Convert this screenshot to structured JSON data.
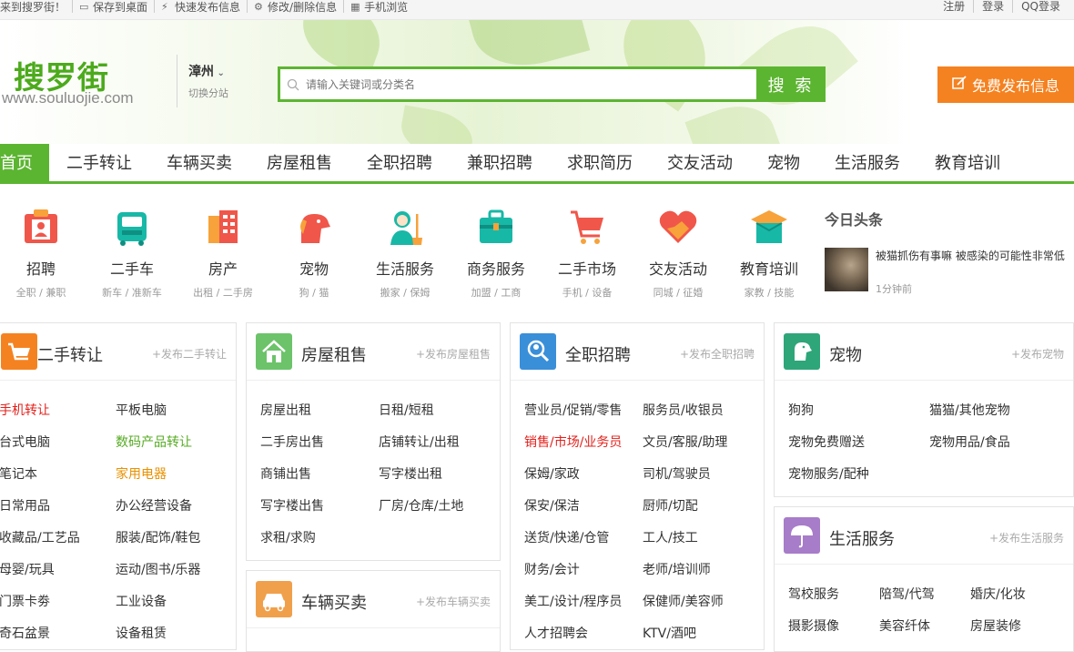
{
  "topbar": {
    "welcome": "迎来到搜罗街！",
    "save_desktop": "保存到桌面",
    "quick_post": "快速发布信息",
    "edit_delete": "修改/删除信息",
    "mobile": "手机浏览",
    "register": "注册",
    "login": "登录",
    "qq_login": "QQ登录"
  },
  "header": {
    "logo_cn": "搜罗街",
    "logo_url": "www.souluojie.com",
    "city": "漳州",
    "switch_city": "切换分站",
    "search_placeholder": "请输入关键词或分类名",
    "search_button": "搜 索",
    "publish_button": "免费发布信息"
  },
  "nav": [
    "首页",
    "二手转让",
    "车辆买卖",
    "房屋租售",
    "全职招聘",
    "兼职招聘",
    "求职简历",
    "交友活动",
    "宠物",
    "生活服务",
    "教育培训"
  ],
  "categories": [
    {
      "name": "招聘",
      "sub": "全职 / 兼职",
      "icon": "recruit-icon"
    },
    {
      "name": "二手车",
      "sub": "新车 / 准新车",
      "icon": "car-icon"
    },
    {
      "name": "房产",
      "sub": "出租 / 二手房",
      "icon": "building-icon"
    },
    {
      "name": "宠物",
      "sub": "狗 / 猫",
      "icon": "dog-icon"
    },
    {
      "name": "生活服务",
      "sub": "搬家 / 保姆",
      "icon": "cleaner-icon"
    },
    {
      "name": "商务服务",
      "sub": "加盟 / 工商",
      "icon": "briefcase-icon"
    },
    {
      "name": "二手市场",
      "sub": "手机 / 设备",
      "icon": "cart-icon"
    },
    {
      "name": "交友活动",
      "sub": "同城 / 征婚",
      "icon": "handshake-icon"
    },
    {
      "name": "教育培训",
      "sub": "家教 / 技能",
      "icon": "graduation-cap-icon"
    }
  ],
  "headline": {
    "title": "今日头条",
    "news_text": "被猫抓伤有事嘛 被感染的可能性非常低",
    "news_time": "1分钟前"
  },
  "panels": {
    "secondhand": {
      "title": "二手转让",
      "link": "+发布二手转让",
      "col1": [
        "手机转让",
        "台式电脑",
        "笔记本",
        "日常用品",
        "收藏品/工艺品",
        "母婴/玩具",
        "门票卡劵",
        "奇石盆景"
      ],
      "col2": [
        "平板电脑",
        "数码产品转让",
        "家用电器",
        "办公经营设备",
        "服装/配饰/鞋包",
        "运动/图书/乐器",
        "工业设备",
        "设备租赁"
      ]
    },
    "house": {
      "title": "房屋租售",
      "link": "+发布房屋租售",
      "col1": [
        "房屋出租",
        "二手房出售",
        "商铺出售",
        "写字楼出售",
        "求租/求购"
      ],
      "col2": [
        "日租/短租",
        "店铺转让/出租",
        "写字楼出租",
        "厂房/仓库/土地"
      ]
    },
    "vehicle": {
      "title": "车辆买卖",
      "link": "+发布车辆买卖"
    },
    "jobs": {
      "title": "全职招聘",
      "link": "+发布全职招聘",
      "col1": [
        "营业员/促销/零售",
        "销售/市场/业务员",
        "保姆/家政",
        "保安/保洁",
        "送货/快递/仓管",
        "财务/会计",
        "美工/设计/程序员",
        "人才招聘会"
      ],
      "col2": [
        "服务员/收银员",
        "文员/客服/助理",
        "司机/驾驶员",
        "厨师/切配",
        "工人/技工",
        "老师/培训师",
        "保健师/美容师",
        "KTV/酒吧"
      ]
    },
    "pets": {
      "title": "宠物",
      "link": "+发布宠物",
      "col1": [
        "狗狗",
        "宠物免费赠送",
        "宠物服务/配种"
      ],
      "col2": [
        "猫猫/其他宠物",
        "宠物用品/食品"
      ]
    },
    "life": {
      "title": "生活服务",
      "link": "+发布生活服务",
      "col1": [
        "驾校服务",
        "摄影摄像"
      ],
      "col2": [
        "陪驾/代驾",
        "美容纤体"
      ],
      "col3": [
        "婚庆/化妆",
        "房屋装修"
      ]
    }
  },
  "colors": {
    "brand_green": "#5cb531",
    "publish_orange": "#f58220",
    "highlight_red": "#e3201b",
    "highlight_green": "#55ab22",
    "highlight_orange": "#e89100"
  }
}
